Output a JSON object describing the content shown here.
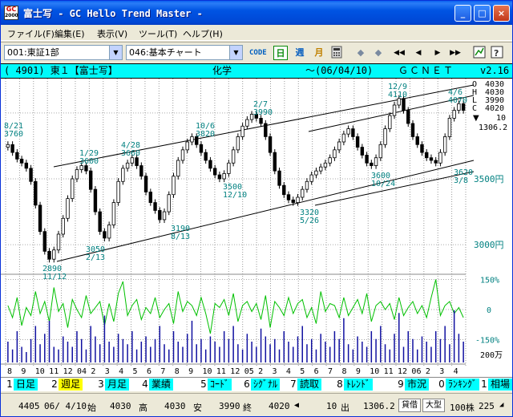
{
  "window": {
    "title": "富士写 - GC Hello Trend Master -",
    "icon_text_top": "GC",
    "icon_text_bottom": "2000",
    "min_label": "_",
    "max_label": "□",
    "close_label": "×"
  },
  "menu": [
    {
      "label": "ファイル(F)"
    },
    {
      "label": "編集(E)"
    },
    {
      "label": "表示(V)"
    },
    {
      "label": "ツール(T)"
    },
    {
      "label": "ヘルプ(H)"
    }
  ],
  "toolbar": {
    "market_select": "001:東証1部",
    "chart_select": "046:基本チャート",
    "code_button": "CODE",
    "day_button": "日",
    "week_button": "週",
    "month_button": "月",
    "calc_icon": "calculator-icon",
    "nav_icons": [
      "arrow-left-icon",
      "arrow-right-icon",
      "rewind-icon",
      "step-back-icon",
      "step-forward-icon",
      "fast-forward-icon"
    ],
    "view_icon": "view-icon",
    "help_icon": "help-icon"
  },
  "info": {
    "code": "( 4901) 東１【富士写】",
    "sector": "化学",
    "date": "～(06/04/10)",
    "brand": "ＧＣＮＥＴ",
    "version": "v2.16"
  },
  "chart_data": {
    "type": "candlestick",
    "ohlc_legend": {
      "labels": [
        "O",
        "H",
        "L",
        "C"
      ],
      "values": [
        "4030",
        "4030",
        "3990",
        "4020"
      ]
    },
    "volume_mark": "10",
    "last_value": "1306.2",
    "price_axis": [
      "3500円",
      "3000円"
    ],
    "oscillator_axis": [
      "150%",
      "0",
      "-150%"
    ],
    "volume_axis": "200万",
    "annotations": [
      {
        "date": "8/21",
        "price": "3760"
      },
      {
        "date": "1/29",
        "price": "3600"
      },
      {
        "date": "4/28",
        "price": "3660"
      },
      {
        "date": "10/6",
        "price": "3820"
      },
      {
        "date": "2/7",
        "price": "3990"
      },
      {
        "date": "12/9",
        "price": "4110"
      },
      {
        "date": "4/6",
        "price": "4070"
      },
      {
        "date": "11/12",
        "price": "2890"
      },
      {
        "date": "2/13",
        "price": "3050"
      },
      {
        "date": "8/13",
        "price": "3190"
      },
      {
        "date": "12/10",
        "price": "3500"
      },
      {
        "date": "5/26",
        "price": "3320"
      },
      {
        "date": "10/24",
        "price": "3600"
      },
      {
        "date": "3/8",
        "price": "3620"
      }
    ],
    "x_labels": [
      "8",
      "9",
      "10",
      "11",
      "12",
      "04",
      "2",
      "3",
      "4",
      "5",
      "6",
      "7",
      "8",
      "9",
      "10",
      "11",
      "12",
      "05",
      "2",
      "3",
      "4",
      "5",
      "6",
      "7",
      "8",
      "9",
      "10",
      "11",
      "12",
      "06",
      "2",
      "3",
      "4"
    ],
    "close_series": [
      3760,
      3700,
      3650,
      3620,
      3580,
      3480,
      3300,
      3100,
      2950,
      2890,
      2960,
      3080,
      3200,
      3350,
      3500,
      3570,
      3600,
      3560,
      3420,
      3250,
      3100,
      3050,
      3150,
      3320,
      3480,
      3580,
      3620,
      3660,
      3600,
      3520,
      3400,
      3320,
      3260,
      3190,
      3250,
      3380,
      3520,
      3640,
      3720,
      3780,
      3820,
      3760,
      3700,
      3640,
      3580,
      3530,
      3500,
      3540,
      3620,
      3720,
      3820,
      3900,
      3950,
      3990,
      3960,
      3920,
      3820,
      3700,
      3560,
      3450,
      3380,
      3340,
      3320,
      3360,
      3420,
      3480,
      3530,
      3560,
      3590,
      3620,
      3660,
      3720,
      3780,
      3840,
      3880,
      3820,
      3740,
      3680,
      3620,
      3600,
      3660,
      3760,
      3880,
      3980,
      4060,
      4110,
      4020,
      3920,
      3820,
      3760,
      3700,
      3660,
      3640,
      3620,
      3700,
      3820,
      3960,
      4020,
      4070,
      4020
    ],
    "oscillator_series": [
      20,
      -40,
      60,
      -80,
      10,
      -30,
      90,
      -20,
      40,
      -60,
      110,
      -10,
      30,
      -90,
      50,
      0,
      -40,
      70,
      -20,
      10,
      40,
      -80,
      30,
      -60,
      80,
      140,
      -30,
      20,
      50,
      -50,
      10,
      -20,
      60,
      -40,
      0,
      30,
      -70,
      90,
      -10,
      40,
      20,
      -30,
      60,
      -20,
      -120,
      30,
      10,
      50,
      -30,
      80,
      -60,
      20,
      40,
      -10,
      30,
      -50,
      70,
      -90,
      40,
      10,
      -30,
      60,
      -20,
      30,
      50,
      -40,
      10,
      -70,
      90,
      -10,
      30,
      20,
      -40,
      60,
      -30,
      10,
      50,
      -20,
      80,
      -60,
      20,
      40,
      0,
      30,
      -50,
      60,
      -30,
      10,
      40,
      -20,
      20,
      -40,
      60,
      150,
      -30,
      20,
      40,
      -20,
      10,
      -40
    ],
    "volume_series": [
      40,
      25,
      60,
      30,
      20,
      45,
      70,
      35,
      55,
      80,
      30,
      25,
      50,
      40,
      30,
      60,
      45,
      25,
      70,
      50,
      35,
      90,
      40,
      30,
      55,
      45,
      35,
      60,
      25,
      40,
      50,
      30,
      45,
      70,
      35,
      25,
      60,
      40,
      30,
      55,
      80,
      35,
      45,
      25,
      50,
      40,
      30,
      60,
      45,
      70,
      35,
      25,
      55,
      40,
      30,
      65,
      50,
      35,
      45,
      25,
      60,
      40,
      30,
      50,
      70,
      35,
      45,
      25,
      55,
      40,
      30,
      60,
      45,
      85,
      35,
      25,
      50,
      40,
      30,
      60,
      45,
      70,
      35,
      25,
      55,
      95,
      30,
      60,
      45,
      25,
      50,
      40,
      30,
      60,
      45,
      70,
      35,
      100,
      55,
      40
    ]
  },
  "fkeys": [
    {
      "num": "1",
      "label": "日足",
      "bg": "#00ffff"
    },
    {
      "num": "2",
      "label": "週足",
      "bg": "#ffff00"
    },
    {
      "num": "3",
      "label": "月足",
      "bg": "#00ffff"
    },
    {
      "num": "4",
      "label": "業績",
      "bg": "#00ffff"
    },
    {
      "num": "5",
      "label": "ｺｰﾄﾞ",
      "bg": "#00ffff"
    },
    {
      "num": "6",
      "label": "ｼｸﾞﾅﾙ",
      "bg": "#00ffff"
    },
    {
      "num": "7",
      "label": "読取",
      "bg": "#00ffff"
    },
    {
      "num": "8",
      "label": "ﾄﾚﾝﾄﾞ",
      "bg": "#00ffff"
    },
    {
      "num": "9",
      "label": "市況",
      "bg": "#00ffff"
    },
    {
      "num": "0",
      "label": "ﾗﾝｷﾝｸﾞ",
      "bg": "#00ffff"
    },
    {
      "num": "1",
      "label": "相場",
      "bg": "#00ffff"
    }
  ],
  "status": {
    "code": "4405",
    "date": "06/ 4/10",
    "open_label": "始",
    "open": "4030",
    "high_label": "高",
    "high": "4030",
    "low_label": "安",
    "low": "3990",
    "close_label": "終",
    "close": "4020",
    "volume": "10",
    "volume_label": "出",
    "index": "1306.2",
    "loan_label": "貸借",
    "size_label": "大型",
    "unit": "100株",
    "page": "225"
  }
}
